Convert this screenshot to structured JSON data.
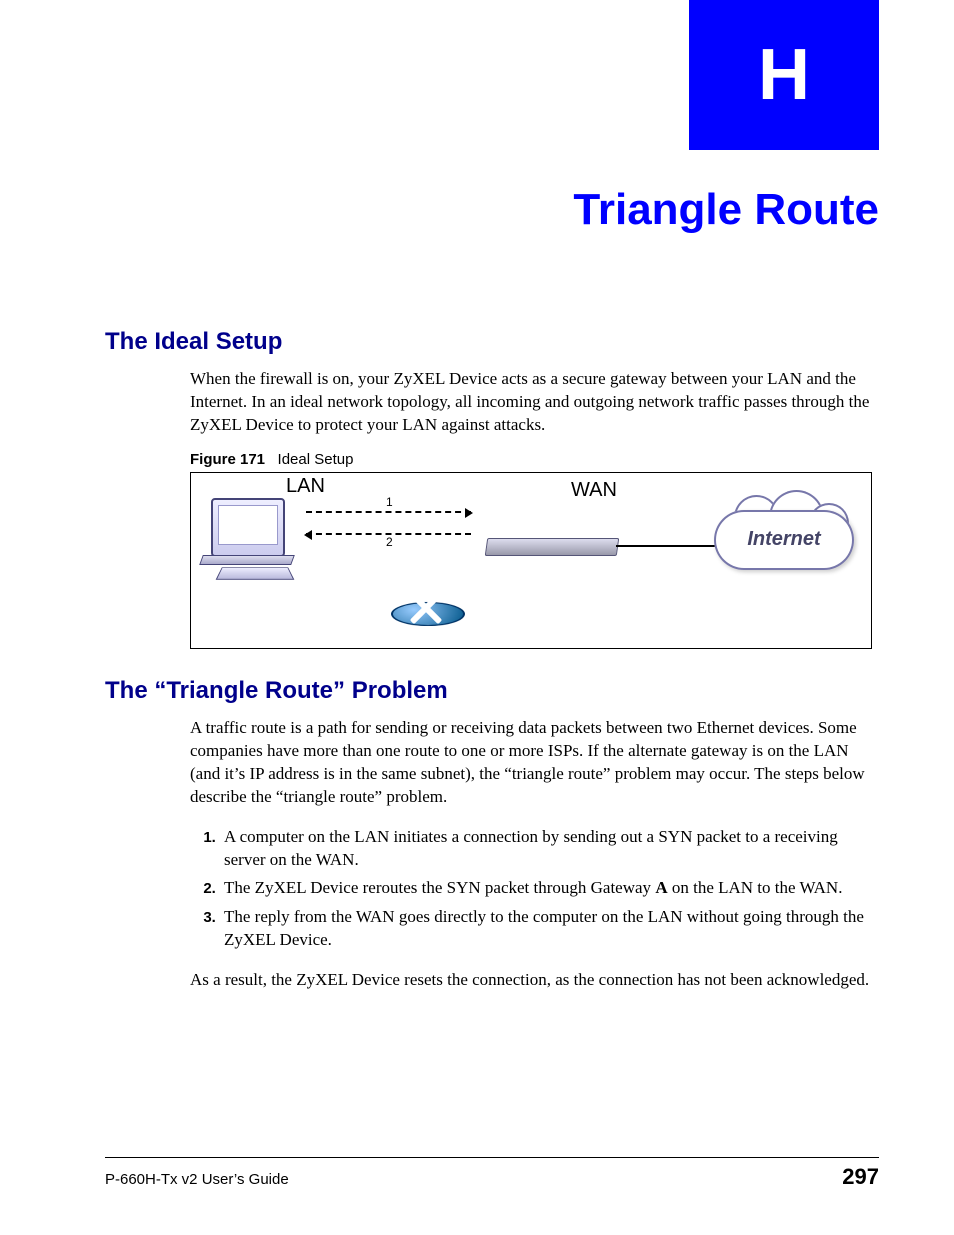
{
  "chapter": {
    "letter": "H",
    "title": "Triangle Route"
  },
  "sections": {
    "ideal": {
      "heading": "The Ideal Setup",
      "para": "When the firewall is on, your ZyXEL Device acts as a secure gateway between your LAN and the Internet. In an ideal network topology, all incoming and outgoing network traffic passes through the ZyXEL Device to protect your LAN against attacks."
    },
    "problem": {
      "heading": "The “Triangle Route” Problem",
      "para": "A traffic route is a path for sending or receiving data packets between two Ethernet devices. Some companies have more than one route to one or more ISPs. If the alternate gateway is on the LAN (and it’s IP address is in the same subnet), the “triangle route” problem may occur. The steps below describe the “triangle route” problem.",
      "steps": [
        "A computer on the LAN initiates a connection by sending out a SYN packet to a receiving server on the WAN.",
        "The ZyXEL Device reroutes the SYN packet through Gateway A on the LAN to the WAN.",
        "The reply from the WAN goes directly to the computer on the LAN without going through the ZyXEL Device."
      ],
      "step2_pre": "The ZyXEL Device reroutes the SYN packet through Gateway ",
      "step2_bold": "A",
      "step2_post": " on the LAN to the WAN.",
      "conclusion": "As a result, the ZyXEL Device resets the connection, as the connection has not been acknowledged."
    }
  },
  "figure": {
    "num": "Figure 171",
    "title": "Ideal Setup",
    "lan_label": "LAN",
    "wan_label": "WAN",
    "internet_label": "Internet",
    "arrow1_num": "1",
    "arrow2_num": "2"
  },
  "footer": {
    "guide": "P-660H-Tx v2 User’s Guide",
    "page": "297"
  }
}
